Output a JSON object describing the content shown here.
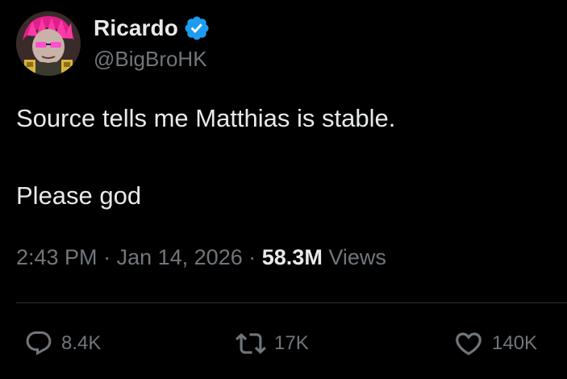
{
  "author": {
    "display_name": "Ricardo",
    "handle": "@BigBroHK",
    "verified": true
  },
  "tweet": {
    "lines": [
      "Source tells me Matthias is stable.",
      "Please god"
    ]
  },
  "meta": {
    "time": "2:43 PM",
    "separator": "·",
    "date": "Jan 14, 2026",
    "views_count": "58.3M",
    "views_label": "Views"
  },
  "actions": {
    "replies": "8.4K",
    "reposts": "17K",
    "likes": "140K"
  },
  "colors": {
    "background": "#000000",
    "text_primary": "#e7e9ea",
    "text_secondary": "#71767b",
    "verified_badge": "#1d9bf0",
    "divider": "#2f3336"
  },
  "icons": {
    "verified": "verified-badge-icon",
    "reply": "reply-icon",
    "repost": "repost-icon",
    "like": "heart-icon"
  }
}
